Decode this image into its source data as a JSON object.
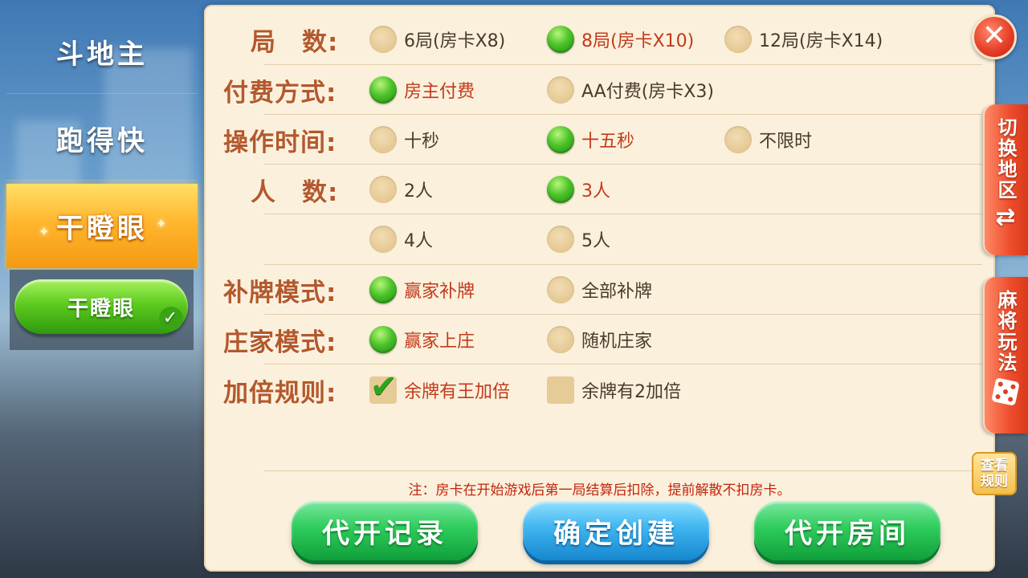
{
  "sidebar": {
    "items": [
      {
        "label": "斗地主"
      },
      {
        "label": "跑得快"
      },
      {
        "label": "干瞪眼"
      }
    ],
    "sub_button": "干瞪眼"
  },
  "settings": {
    "rounds": {
      "label": "局　数:",
      "options": [
        "6局(房卡X8)",
        "8局(房卡X10)",
        "12局(房卡X14)"
      ],
      "selected": "8局(房卡X10)"
    },
    "payment": {
      "label": "付费方式:",
      "options": [
        "房主付费",
        "AA付费(房卡X3)"
      ],
      "selected": "房主付费"
    },
    "timer": {
      "label": "操作时间:",
      "options": [
        "十秒",
        "十五秒",
        "不限时"
      ],
      "selected": "十五秒"
    },
    "players": {
      "label": "人　数:",
      "options": [
        "2人",
        "3人",
        "4人",
        "5人"
      ],
      "selected": "3人"
    },
    "draw_mode": {
      "label": "补牌模式:",
      "options": [
        "赢家补牌",
        "全部补牌"
      ],
      "selected": "赢家补牌"
    },
    "dealer_mode": {
      "label": "庄家模式:",
      "options": [
        "赢家上庄",
        "随机庄家"
      ],
      "selected": "赢家上庄"
    },
    "double_rules": {
      "label": "加倍规则:",
      "options": [
        "余牌有王加倍",
        "余牌有2加倍"
      ],
      "checked": [
        "余牌有王加倍"
      ]
    }
  },
  "note": "注：房卡在开始游戏后第一局结算后扣除，提前解散不扣房卡。",
  "actions": {
    "proxy_records": "代开记录",
    "confirm_create": "确定创建",
    "proxy_room": "代开房间"
  },
  "close_symbol": "✕",
  "right_tabs": {
    "switch_region": "切换地区",
    "mahjong_modes": "麻将玩法",
    "view_rules_line1": "查看",
    "view_rules_line2": "规则"
  },
  "colors": {
    "panel_bg": "#fbf0dc",
    "label_brown": "#b3592c",
    "selected_red": "#c23a1b",
    "radio_on_green": "#2fa41c",
    "active_tab_gold": "#ffb62e"
  }
}
